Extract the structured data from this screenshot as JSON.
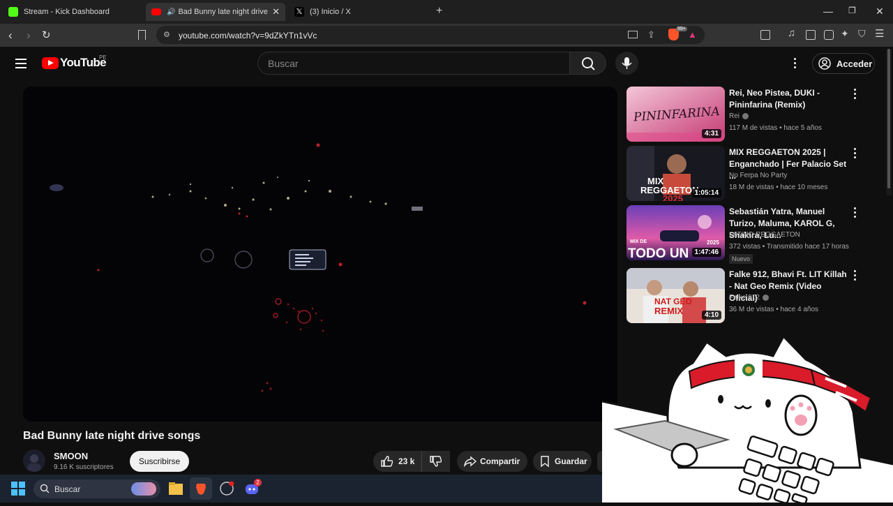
{
  "browser": {
    "tabs": [
      {
        "title": "Stream - Kick Dashboard",
        "active": false
      },
      {
        "title": "Bad Bunny late night drive so",
        "active": true
      },
      {
        "title": "(3) Inicio / X",
        "active": false
      }
    ],
    "url": "youtube.com/watch?v=9dZkYTn1vVc",
    "brave_badge": "99+"
  },
  "youtube": {
    "logo_text": "YouTube",
    "region": "PE",
    "search_placeholder": "Buscar",
    "signin_label": "Acceder"
  },
  "video": {
    "title": "Bad Bunny late night drive songs",
    "channel": "SMOON",
    "subscribers": "9.16 K suscriptores",
    "subscribe_label": "Suscribirse",
    "likes": "23 k",
    "share_label": "Compartir",
    "save_label": "Guardar"
  },
  "recommendations": [
    {
      "title": "Rei, Neo Pistea, DUKI - Pininfarina (Remix)",
      "channel": "Rei",
      "verified": true,
      "meta": "117 M de vistas • hace 5 años",
      "duration": "4:31",
      "thumb_text": "PININFARINA",
      "badge": ""
    },
    {
      "title": "MIX REGGAETON 2025 | Enganchado | Fer Palacio Set ...",
      "channel": "No Ferpa No Party",
      "verified": false,
      "meta": "18 M de vistas • hace 10 meses",
      "duration": "1:05:14",
      "thumb_text": "MIX REGGAETON 2025",
      "badge": ""
    },
    {
      "title": "Sebastián Yatra, Manuel Turizo, Maluma, KAROL G, Shakira, Lu...",
      "channel": "LATINO REGGAETON",
      "verified": false,
      "meta": "372 vistas • Transmitido hace 17 horas",
      "duration": "1:47:46",
      "thumb_text": "TODO UN",
      "badge": "Nuevo"
    },
    {
      "title": "Falke 912, Bhavi Ft. LIT Killah - Nat Geo Remix (Video Oficial)",
      "channel": "Falke 912",
      "verified": true,
      "meta": "36 M de vistas • hace 4 años",
      "duration": "4:10",
      "thumb_text": "NAT GEO REMIX",
      "badge": ""
    }
  ],
  "taskbar": {
    "search_label": "Buscar",
    "discord_badge": "2"
  },
  "colors": {
    "youtube_red": "#ff0000",
    "background": "#0f0f0f",
    "kick_green": "#53fc18"
  }
}
